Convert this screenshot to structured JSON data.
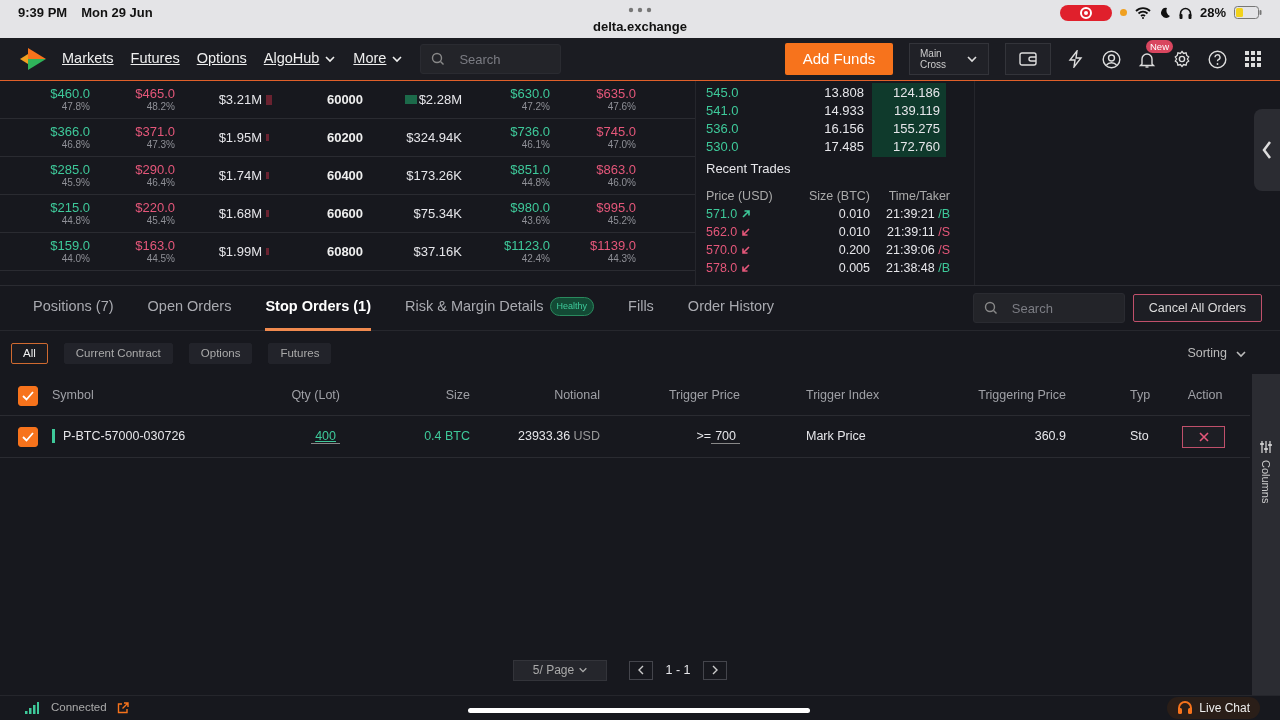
{
  "status_bar": {
    "time": "9:39 PM",
    "date": "Mon 29 Jun",
    "url": "delta.exchange",
    "battery": "28%"
  },
  "nav": {
    "menu": [
      {
        "label": "Markets",
        "dropdown": false
      },
      {
        "label": "Futures",
        "dropdown": false
      },
      {
        "label": "Options",
        "dropdown": false
      },
      {
        "label": "AlgoHub",
        "dropdown": true
      },
      {
        "label": "More",
        "dropdown": true
      }
    ],
    "search_placeholder": "Search",
    "add_funds": "Add Funds",
    "account": [
      "Main",
      "Cross"
    ],
    "notification_badge": "New"
  },
  "option_chain": {
    "rows": [
      {
        "call_bid": "$460.0",
        "call_bid_pct": "47.8%",
        "call_ask": "$465.0",
        "call_ask_pct": "48.2%",
        "call_volume": "$3.21M",
        "strike": "60000",
        "put_volume": "$2.28M",
        "put_bid": "$630.0",
        "put_bid_pct": "47.2%",
        "put_ask": "$635.0",
        "put_ask_pct": "47.6%"
      },
      {
        "call_bid": "$366.0",
        "call_bid_pct": "46.8%",
        "call_ask": "$371.0",
        "call_ask_pct": "47.3%",
        "call_volume": "$1.95M",
        "strike": "60200",
        "put_volume": "$324.94K",
        "put_bid": "$736.0",
        "put_bid_pct": "46.1%",
        "put_ask": "$745.0",
        "put_ask_pct": "47.0%"
      },
      {
        "call_bid": "$285.0",
        "call_bid_pct": "45.9%",
        "call_ask": "$290.0",
        "call_ask_pct": "46.4%",
        "call_volume": "$1.74M",
        "strike": "60400",
        "put_volume": "$173.26K",
        "put_bid": "$851.0",
        "put_bid_pct": "44.8%",
        "put_ask": "$863.0",
        "put_ask_pct": "46.0%"
      },
      {
        "call_bid": "$215.0",
        "call_bid_pct": "44.8%",
        "call_ask": "$220.0",
        "call_ask_pct": "45.4%",
        "call_volume": "$1.68M",
        "strike": "60600",
        "put_volume": "$75.34K",
        "put_bid": "$980.0",
        "put_bid_pct": "43.6%",
        "put_ask": "$995.0",
        "put_ask_pct": "45.2%"
      },
      {
        "call_bid": "$159.0",
        "call_bid_pct": "44.0%",
        "call_ask": "$163.0",
        "call_ask_pct": "44.5%",
        "call_volume": "$1.99M",
        "strike": "60800",
        "put_volume": "$37.16K",
        "put_bid": "$1123.0",
        "put_bid_pct": "42.4%",
        "put_ask": "$1139.0",
        "put_ask_pct": "44.3%"
      }
    ]
  },
  "order_book": {
    "rows": [
      {
        "price": "545.0",
        "size": "13.808",
        "total": "124.186"
      },
      {
        "price": "541.0",
        "size": "14.933",
        "total": "139.119"
      },
      {
        "price": "536.0",
        "size": "16.156",
        "total": "155.275"
      },
      {
        "price": "530.0",
        "size": "17.485",
        "total": "172.760"
      }
    ]
  },
  "recent_trades": {
    "title": "Recent Trades",
    "columns": [
      "Price (USD)",
      "Size (BTC)",
      "Time/Taker"
    ],
    "rows": [
      {
        "price": "571.0",
        "kind": "buy",
        "size": "0.010",
        "time": "21:39:21",
        "taker": "/B"
      },
      {
        "price": "562.0",
        "kind": "sell",
        "size": "0.010",
        "time": "21:39:11",
        "taker": "/S"
      },
      {
        "price": "570.0",
        "kind": "sell",
        "size": "0.200",
        "time": "21:39:06",
        "taker": "/S"
      },
      {
        "price": "578.0",
        "kind": "sell",
        "size": "0.005",
        "time": "21:38:48",
        "taker": "/B"
      }
    ]
  },
  "bottom": {
    "tabs": [
      {
        "label": "Positions (7)",
        "selected": false
      },
      {
        "label": "Open Orders",
        "selected": false
      },
      {
        "label": "Stop Orders (1)",
        "selected": true
      },
      {
        "label": "Risk & Margin Details",
        "badge": "Healthy",
        "selected": false
      },
      {
        "label": "Fills",
        "selected": false
      },
      {
        "label": "Order History",
        "selected": false
      }
    ],
    "search_placeholder": "Search",
    "cancel_all": "Cancel All Orders",
    "filters": [
      {
        "label": "All",
        "selected": true
      },
      {
        "label": "Current Contract",
        "selected": false
      },
      {
        "label": "Options",
        "selected": false
      },
      {
        "label": "Futures",
        "selected": false
      }
    ],
    "sorting": "Sorting",
    "table": {
      "all_checked": true,
      "columns": [
        "Symbol",
        "Qty (Lot)",
        "Size",
        "Notional",
        "Trigger Price",
        "Trigger Index",
        "Triggering Price",
        "Typ",
        "Action"
      ],
      "rows": [
        {
          "checked": true,
          "symbol": "P-BTC-57000-030726",
          "qty": "400",
          "size": "0.4 BTC",
          "notional": "23933.36",
          "notional_unit": "USD",
          "trigger_op": ">=",
          "trigger_price": "700",
          "trigger_index": "Mark Price",
          "triggering_price": "360.9",
          "type": "Sto"
        }
      ]
    },
    "columns_label": "Columns",
    "pagination": {
      "per_page": "5/ Page",
      "range": "1 - 1"
    }
  },
  "footer": {
    "connection": "Connected",
    "live_chat": "Live Chat"
  }
}
